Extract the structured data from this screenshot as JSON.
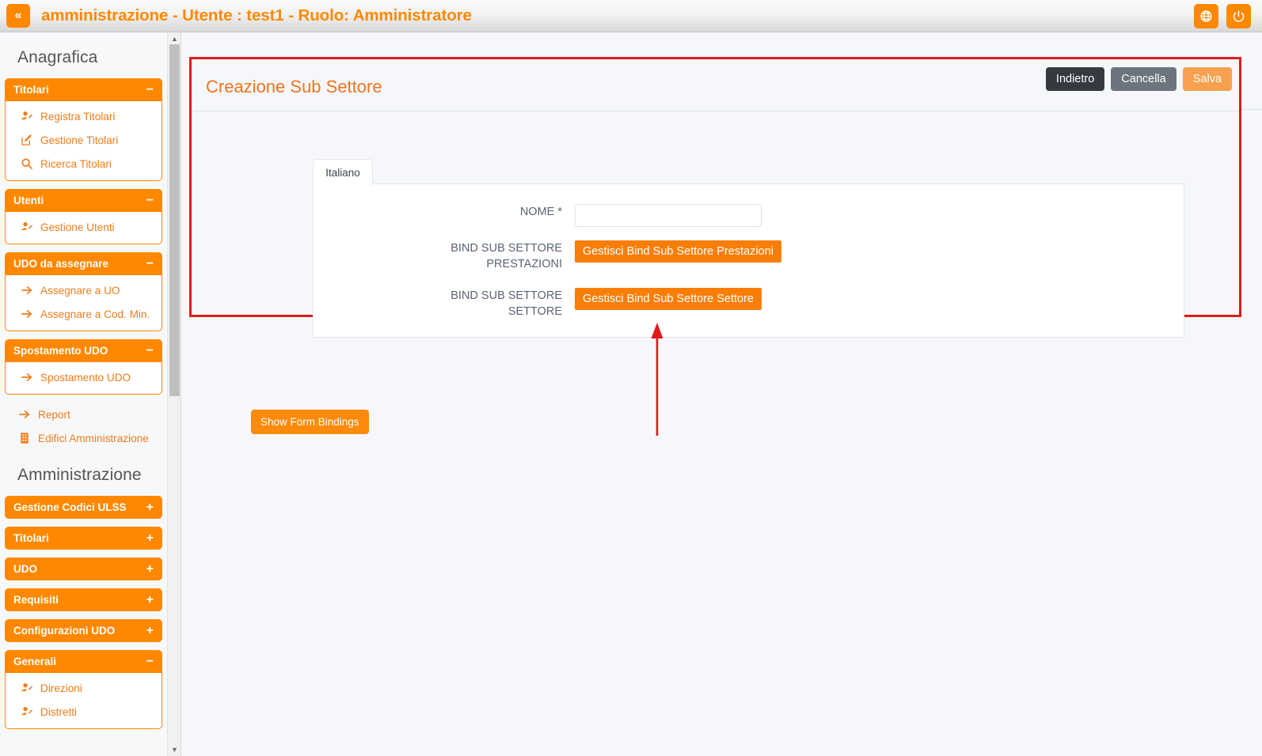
{
  "topbar": {
    "collapse_icon": "double-chevron-left-icon",
    "collapse_label": "«",
    "title": "amministrazione - Utente : test1 - Ruolo: Amministratore",
    "language_icon": "globe-icon",
    "logout_icon": "power-icon"
  },
  "sidebar": {
    "sections": [
      {
        "heading": "Anagrafica",
        "groups": [
          {
            "label": "Titolari",
            "sign": "−",
            "expanded": true,
            "items": [
              {
                "label": "Registra Titolari",
                "icon": "user-add-icon"
              },
              {
                "label": "Gestione Titolari",
                "icon": "edit-square-icon"
              },
              {
                "label": "Ricerca Titolari",
                "icon": "search-icon"
              }
            ]
          },
          {
            "label": "Utenti",
            "sign": "−",
            "expanded": true,
            "items": [
              {
                "label": "Gestione Utenti",
                "icon": "user-add-icon"
              }
            ]
          },
          {
            "label": "UDO da assegnare",
            "sign": "−",
            "expanded": true,
            "items": [
              {
                "label": "Assegnare a UO",
                "icon": "arrow-right-icon"
              },
              {
                "label": "Assegnare a Cod. Min.",
                "icon": "arrow-right-icon"
              }
            ]
          },
          {
            "label": "Spostamento UDO",
            "sign": "−",
            "expanded": true,
            "items": [
              {
                "label": "Spostamento UDO",
                "icon": "arrow-right-icon"
              }
            ]
          }
        ],
        "loose_items": [
          {
            "label": "Report",
            "icon": "arrow-right-icon"
          },
          {
            "label": "Edifici Amministrazione",
            "icon": "building-icon"
          }
        ]
      },
      {
        "heading": "Amministrazione",
        "groups": [
          {
            "label": "Gestione Codici ULSS",
            "sign": "+",
            "expanded": false,
            "items": []
          },
          {
            "label": "Titolari",
            "sign": "+",
            "expanded": false,
            "items": []
          },
          {
            "label": "UDO",
            "sign": "+",
            "expanded": false,
            "items": []
          },
          {
            "label": "Requisiti",
            "sign": "+",
            "expanded": false,
            "items": []
          },
          {
            "label": "Configurazioni UDO",
            "sign": "+",
            "expanded": false,
            "items": []
          },
          {
            "label": "Generali",
            "sign": "−",
            "expanded": true,
            "items": [
              {
                "label": "Direzioni",
                "icon": "user-add-icon"
              },
              {
                "label": "Distretti",
                "icon": "user-add-icon"
              }
            ]
          }
        ],
        "loose_items": []
      }
    ],
    "scrollbar": {
      "up_arrow": "triangle-up-icon",
      "down_arrow": "triangle-down-icon"
    }
  },
  "main": {
    "page_title": "Creazione Sub Settore",
    "actions": [
      {
        "label": "Indietro",
        "style": "act-dark",
        "name": "back-button"
      },
      {
        "label": "Cancella",
        "style": "act-gray",
        "name": "cancel-button"
      },
      {
        "label": "Salva",
        "style": "act-orange",
        "name": "save-button"
      }
    ],
    "lang_tab": "Italiano",
    "form": {
      "rows": [
        {
          "label": "NOME *",
          "type": "input",
          "value": "",
          "placeholder": ""
        },
        {
          "label": "BIND SUB SETTORE\nPRESTAZIONI",
          "type": "button",
          "button_label": "Gestisci Bind Sub Settore Prestazioni"
        },
        {
          "label": "BIND SUB SETTORE\nSETTORE",
          "type": "button",
          "button_label": "Gestisci Bind Sub Settore Settore"
        }
      ]
    },
    "show_bindings_label": "Show Form Bindings",
    "annotation": {
      "highlight_color": "#e01b1b",
      "arrow_color": "#e01b1b",
      "arrow_direction": "up"
    }
  },
  "colors": {
    "accent_orange": "#ff8800",
    "button_orange": "#f97e08",
    "title_orange": "#f0731f",
    "annotation_red": "#e01b1b",
    "dark_button": "#343a40",
    "gray_button": "#6c757d"
  }
}
